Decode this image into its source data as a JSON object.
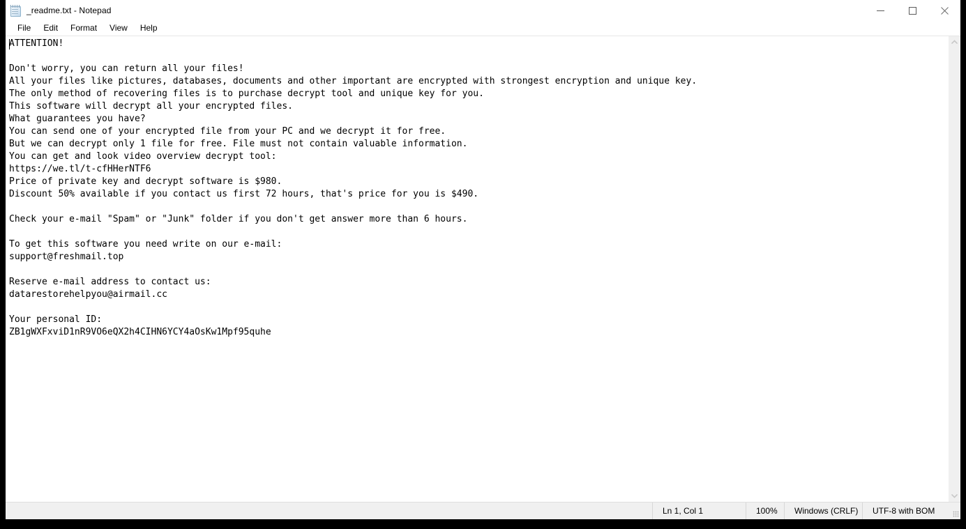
{
  "window": {
    "title": "_readme.txt - Notepad",
    "icon": "notepad-icon",
    "controls": {
      "minimize_label": "Minimize",
      "maximize_label": "Maximize",
      "close_label": "Close"
    }
  },
  "menu": {
    "items": [
      {
        "label": "File"
      },
      {
        "label": "Edit"
      },
      {
        "label": "Format"
      },
      {
        "label": "View"
      },
      {
        "label": "Help"
      }
    ]
  },
  "editor": {
    "content": "ATTENTION!\n\nDon't worry, you can return all your files!\nAll your files like pictures, databases, documents and other important are encrypted with strongest encryption and unique key.\nThe only method of recovering files is to purchase decrypt tool and unique key for you.\nThis software will decrypt all your encrypted files.\nWhat guarantees you have?\nYou can send one of your encrypted file from your PC and we decrypt it for free.\nBut we can decrypt only 1 file for free. File must not contain valuable information.\nYou can get and look video overview decrypt tool:\nhttps://we.tl/t-cfHHerNTF6\nPrice of private key and decrypt software is $980.\nDiscount 50% available if you contact us first 72 hours, that's price for you is $490.\n\nCheck your e-mail \"Spam\" or \"Junk\" folder if you don't get answer more than 6 hours.\n\nTo get this software you need write on our e-mail:\nsupport@freshmail.top\n\nReserve e-mail address to contact us:\ndatarestorehelpyou@airmail.cc\n\nYour personal ID:\nZB1gWXFxviD1nR9VO6eQX2h4CIHN6YCY4aOsKw1Mpf95quhe",
    "lines": [
      "ATTENTION!",
      "",
      "Don't worry, you can return all your files!",
      "All your files like pictures, databases, documents and other important are encrypted with strongest encryption and unique key.",
      "The only method of recovering files is to purchase decrypt tool and unique key for you.",
      "This software will decrypt all your encrypted files.",
      "What guarantees you have?",
      "You can send one of your encrypted file from your PC and we decrypt it for free.",
      "But we can decrypt only 1 file for free. File must not contain valuable information.",
      "You can get and look video overview decrypt tool:",
      "https://we.tl/t-cfHHerNTF6",
      "Price of private key and decrypt software is $980.",
      "Discount 50% available if you contact us first 72 hours, that's price for you is $490.",
      "",
      "Check your e-mail \"Spam\" or \"Junk\" folder if you don't get answer more than 6 hours.",
      "",
      "To get this software you need write on our e-mail:",
      "support@freshmail.top",
      "",
      "Reserve e-mail address to contact us:",
      "datarestorehelpyou@airmail.cc",
      "",
      "Your personal ID:",
      "ZB1gWXFxviD1nR9VO6eQX2h4CIHN6YCY4aOsKw1Mpf95quhe"
    ],
    "details": {
      "video_url": "https://we.tl/t-cfHHerNTF6",
      "price_full": "$980",
      "price_discount": "$490",
      "discount_percent": "50%",
      "discount_window_hours": "72",
      "answer_time_hours": "6",
      "primary_email": "support@freshmail.top",
      "reserve_email": "datarestorehelpyou@airmail.cc",
      "personal_id": "ZB1gWXFxviD1nR9VO6eQX2h4CIHN6YCY4aOsKw1Mpf95quhe"
    }
  },
  "scrollbar": {
    "up_arrow": "chevron-up-icon",
    "down_arrow": "chevron-down-icon"
  },
  "status_bar": {
    "position": "Ln 1, Col 1",
    "zoom": "100%",
    "line_ending": "Windows (CRLF)",
    "encoding": "UTF-8 with BOM"
  },
  "colors": {
    "window_bg": "#ffffff",
    "chrome_bg": "#f0f0f0",
    "text": "#000000",
    "backdrop": "#000000",
    "separator": "#d7d7d7"
  }
}
